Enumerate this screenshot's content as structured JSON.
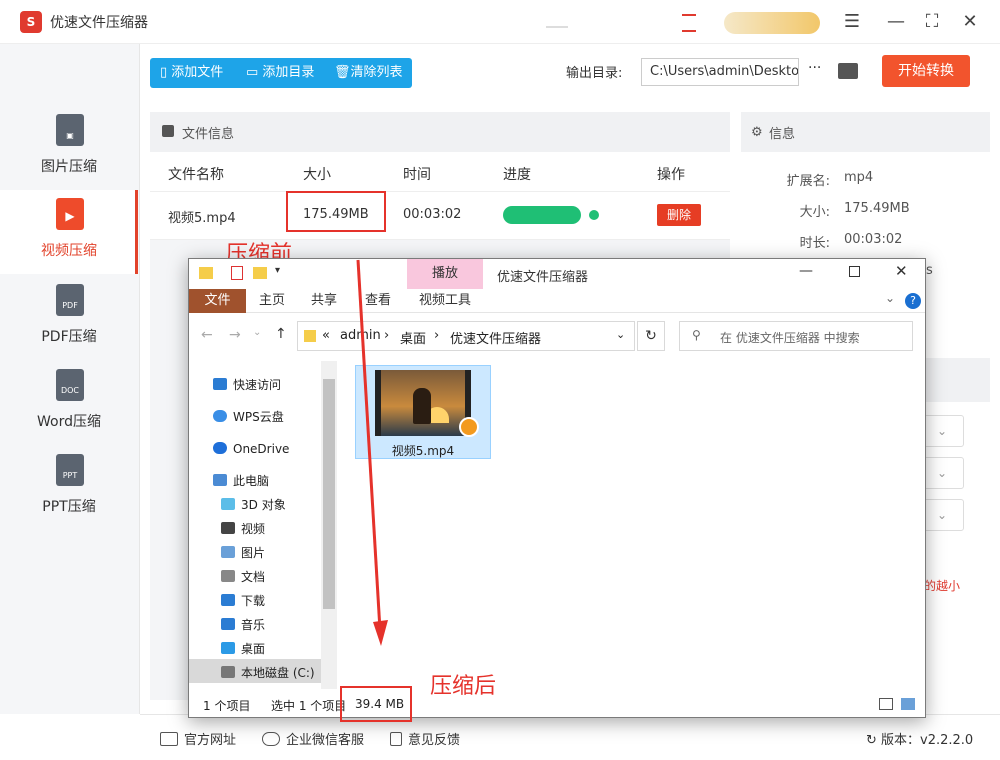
{
  "app": {
    "title": "优速文件压缩器",
    "logo": "S"
  },
  "sidebar": {
    "items": [
      {
        "label": "图片压缩",
        "icon": "image-file-icon",
        "tag": ""
      },
      {
        "label": "视频压缩",
        "icon": "video-file-icon",
        "tag": ""
      },
      {
        "label": "PDF压缩",
        "icon": "pdf-file-icon",
        "tag": "PDF"
      },
      {
        "label": "Word压缩",
        "icon": "doc-file-icon",
        "tag": "DOC"
      },
      {
        "label": "PPT压缩",
        "icon": "ppt-file-icon",
        "tag": "PPT"
      }
    ],
    "active_index": 1
  },
  "toolbar": {
    "add_file": "添加文件",
    "add_dir": "添加目录",
    "clear_list": "清除列表",
    "output_label": "输出目录:",
    "output_path": "C:\\Users\\admin\\Desktop",
    "more": "···",
    "start": "开始转换"
  },
  "file_panel": {
    "title": "文件信息",
    "columns": [
      "文件名称",
      "大小",
      "时间",
      "进度",
      "操作"
    ],
    "rows": [
      {
        "name": "视频5.mp4",
        "size": "175.49MB",
        "time": "00:03:02",
        "progress": 1.0,
        "action": "删除"
      }
    ]
  },
  "info_panel": {
    "title": "信息",
    "ext_label": "扩展名:",
    "ext": "mp4",
    "size_label": "大小:",
    "size": "175.49MB",
    "duration_label": "时长:",
    "duration": "00:03:02",
    "partial_s": "s",
    "partial_red": "的越小"
  },
  "annotations": {
    "before": "压缩前",
    "after": "压缩后"
  },
  "explorer": {
    "play_tab": "播放",
    "title": "优速文件压缩器",
    "ribbon": [
      "文件",
      "主页",
      "共享",
      "查看",
      "视频工具"
    ],
    "path": [
      "«",
      "admin",
      "›",
      "桌面",
      "›",
      "优速文件压缩器"
    ],
    "search_placeholder": "在 优速文件压缩器 中搜索",
    "nav": [
      {
        "label": "快速访问",
        "icon": "star-icon",
        "color": "#2b7cd3"
      },
      {
        "label": "WPS云盘",
        "icon": "cloud-icon",
        "color": "#3a8ee6"
      },
      {
        "label": "OneDrive",
        "icon": "onedrive-icon",
        "color": "#1e6fd9"
      },
      {
        "label": "此电脑",
        "icon": "computer-icon",
        "color": "#4b8bd4"
      },
      {
        "label": "3D 对象",
        "icon": "cube-icon",
        "color": "#5bbde8"
      },
      {
        "label": "视频",
        "icon": "video-folder-icon",
        "color": "#444"
      },
      {
        "label": "图片",
        "icon": "picture-folder-icon",
        "color": "#6aa0d8"
      },
      {
        "label": "文档",
        "icon": "document-folder-icon",
        "color": "#888"
      },
      {
        "label": "下载",
        "icon": "download-icon",
        "color": "#2b7cd3"
      },
      {
        "label": "音乐",
        "icon": "music-icon",
        "color": "#2b7cd3"
      },
      {
        "label": "桌面",
        "icon": "desktop-icon",
        "color": "#2b9ae6"
      },
      {
        "label": "本地磁盘 (C:)",
        "icon": "disk-icon",
        "color": "#777"
      }
    ],
    "file": {
      "name": "视频5.mp4"
    },
    "status": {
      "count": "1 个项目",
      "selected": "选中 1 个项目",
      "size": "39.4 MB"
    }
  },
  "footer": {
    "website": "官方网址",
    "wechat": "企业微信客服",
    "feedback": "意见反馈",
    "version": "版本：v2.2.2.0"
  }
}
